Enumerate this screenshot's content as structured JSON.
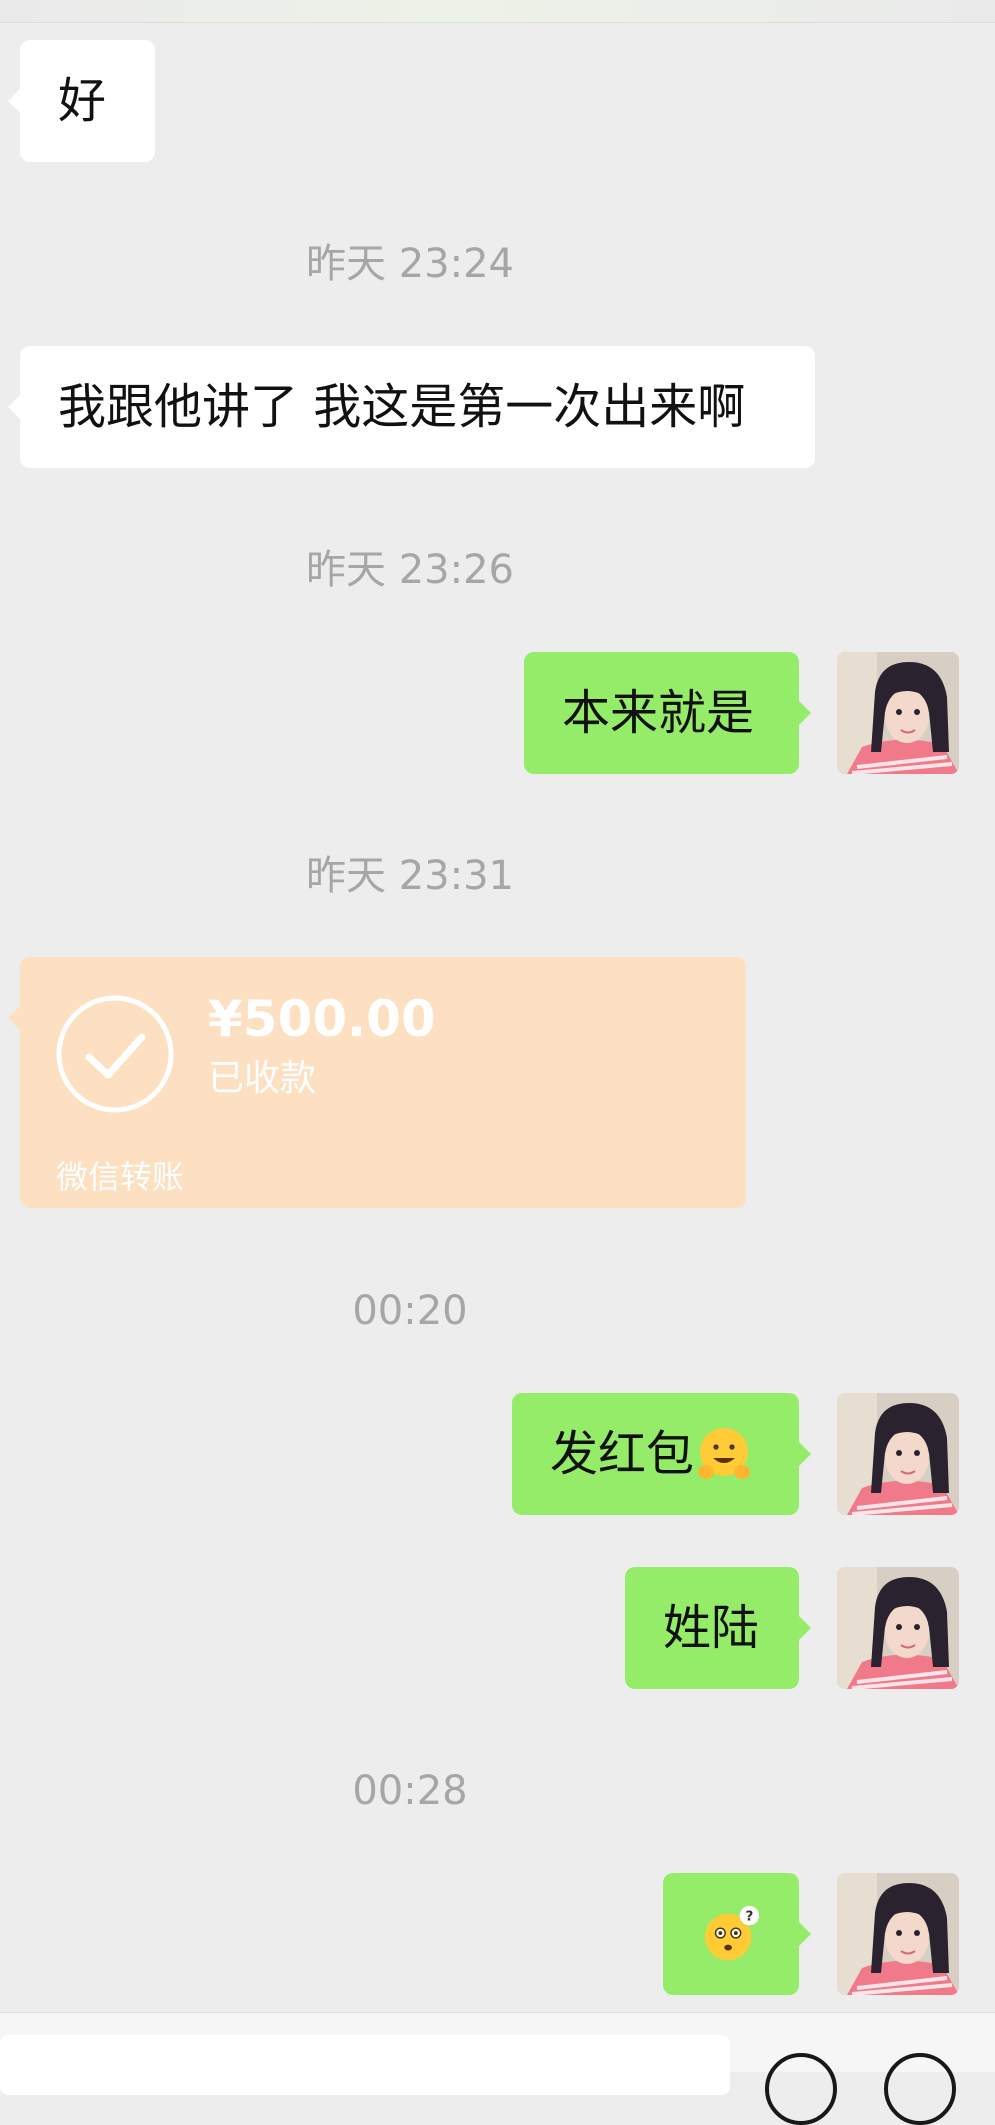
{
  "messages": {
    "m1": {
      "text": "好"
    },
    "t1": {
      "text": "昨天 23:24"
    },
    "m2": {
      "text": "我跟他讲了 我这是第一次出来啊"
    },
    "t2": {
      "text": "昨天 23:26"
    },
    "m3": {
      "text": "本来就是"
    },
    "t3": {
      "text": "昨天 23:31"
    },
    "transfer": {
      "amount": "¥500.00",
      "status": "已收款",
      "footer": "微信转账"
    },
    "t4": {
      "text": "00:20"
    },
    "m4": {
      "text": "发红包",
      "emoji": "smiling-hands-emoji"
    },
    "m5": {
      "text": "姓陆"
    },
    "t5": {
      "text": "00:28"
    },
    "m6": {
      "emoji": "confused-question-emoji"
    }
  },
  "colors": {
    "background": "#ededed",
    "incoming_bubble": "#ffffff",
    "outgoing_bubble": "#95ec69",
    "transfer_card": "#fce0c1",
    "timestamp": "#a6a6a6"
  },
  "icons": {
    "transfer": "check-circle-icon",
    "input_left": "voice-icon",
    "input_right_1": "emoji-icon",
    "input_right_2": "plus-icon"
  }
}
